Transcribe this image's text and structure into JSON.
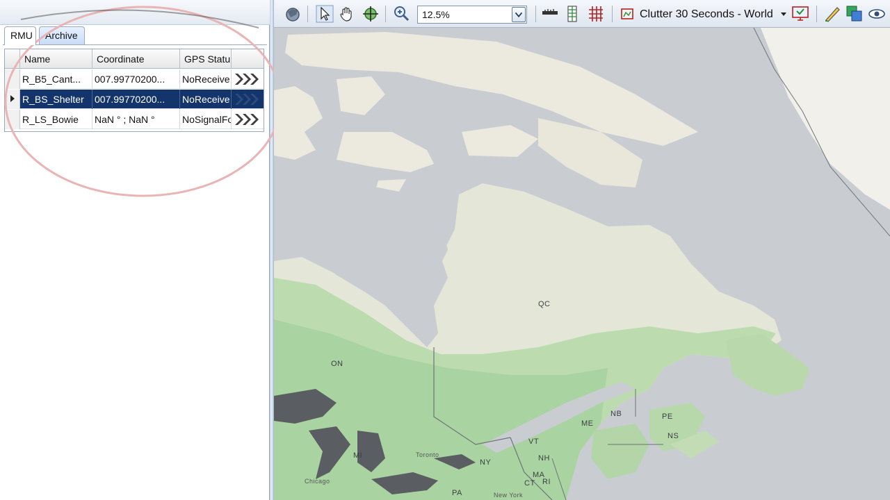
{
  "tabs": [
    {
      "label": "RMU",
      "active": true
    },
    {
      "label": "Archive",
      "active": false
    }
  ],
  "grid": {
    "columns": [
      "Name",
      "Coordinate",
      "GPS Statu"
    ],
    "rows": [
      {
        "name": "R_B5_Cant...",
        "coordinate": "007.99770200...",
        "gps_status": "NoReceive",
        "selected": false
      },
      {
        "name": "R_BS_Shelter",
        "coordinate": "007.99770200...",
        "gps_status": "NoReceive",
        "selected": true
      },
      {
        "name": "R_LS_Bowie",
        "coordinate": "NaN ° ; NaN °",
        "gps_status": "NoSignalFo",
        "selected": false
      }
    ],
    "row_action_icon": "triple-chevron-right-icon"
  },
  "toolbar": {
    "zoom_value": "12.5%",
    "layer_label": "Clutter 30 Seconds - World",
    "icons": [
      "globe-layers-icon",
      "select-pointer-icon",
      "pan-hand-icon",
      "center-target-icon",
      "zoom-in-icon",
      "ruler-icon",
      "grid-legend-icon",
      "grid-overlay-icon",
      "clutter-layer-icon",
      "screen-export-icon",
      "measure-pencil-icon",
      "copy-layers-icon",
      "eye-view-icon"
    ]
  },
  "map": {
    "labels": [
      "ON",
      "QC",
      "NB",
      "NS",
      "PE",
      "ME",
      "VT",
      "NH",
      "MA",
      "CT",
      "RI",
      "NY",
      "PA",
      "MI",
      "Toronto",
      "Chicago",
      "New York"
    ]
  },
  "colors": {
    "selection": "#14356b",
    "water": "#c9cdd2",
    "land_tundra": "#ece9de",
    "land_forest": "#a9d3a0",
    "annotation_circle": "#e8b4b4"
  }
}
